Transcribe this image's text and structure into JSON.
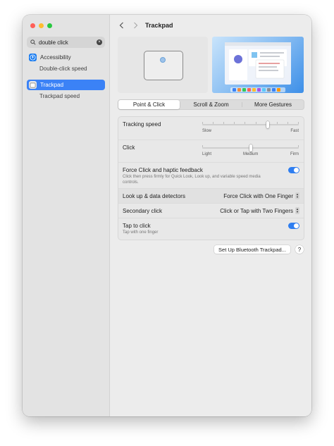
{
  "window": {
    "title": "Trackpad"
  },
  "search": {
    "value": "double click"
  },
  "sidebar": {
    "results": [
      {
        "label": "Accessibility",
        "sub": "Double-click speed",
        "icon": "accessibility-icon"
      },
      {
        "label": "Trackpad",
        "sub": "Trackpad speed",
        "icon": "trackpad-icon",
        "selected": true
      }
    ]
  },
  "tabs": [
    "Point & Click",
    "Scroll & Zoom",
    "More Gestures"
  ],
  "settings": {
    "tracking_speed": {
      "label": "Tracking speed",
      "min_label": "Slow",
      "max_label": "Fast",
      "level": 0.68
    },
    "click": {
      "label": "Click",
      "labels": [
        "Light",
        "Medium",
        "Firm"
      ],
      "level": 0.5
    },
    "force_click": {
      "label": "Force Click and haptic feedback",
      "description": "Click then press firmly for Quick Look, Look up, and variable speed media controls.",
      "enabled": true
    },
    "lookup": {
      "label": "Look up & data detectors",
      "value": "Force Click with One Finger"
    },
    "secondary_click": {
      "label": "Secondary click",
      "value": "Click or Tap with Two Fingers"
    },
    "tap_to_click": {
      "label": "Tap to click",
      "description": "Tap with one finger",
      "enabled": true
    }
  },
  "buttons": {
    "bluetooth": "Set Up Bluetooth Trackpad...",
    "help": "?"
  },
  "colors": {
    "accent": "#2f7ef0",
    "selection": "#3b82f6",
    "close": "#ff5f57",
    "minimize": "#febc2e",
    "maximize": "#28c840"
  }
}
